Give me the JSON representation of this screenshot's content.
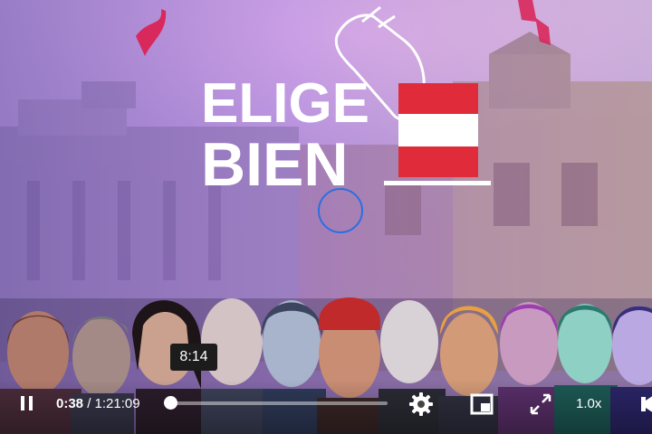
{
  "video": {
    "logo_line1": "ELIGE",
    "logo_line2": "BIEN"
  },
  "controls": {
    "current_time": "0:38",
    "separator": "/",
    "duration": "1:21:09",
    "hover_time": "8:14",
    "speed": "1.0x",
    "progress_fraction": 0.008,
    "icons": [
      "pause-icon",
      "settings-gear-icon",
      "picture-in-picture-icon",
      "fullscreen-icon",
      "volume-icon"
    ]
  },
  "colors": {
    "flag_red": "#E02C3A",
    "overlay_purple": "#8E5AD6",
    "cursor_ring": "#2A6FE0"
  }
}
